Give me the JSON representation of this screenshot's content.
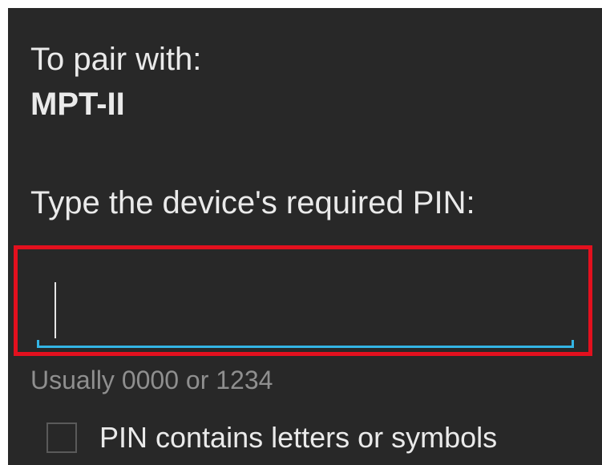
{
  "dialog": {
    "pair_label": "To pair with:",
    "device_name": "MPT-II",
    "pin_prompt": "Type the device's required PIN:",
    "pin_input": {
      "value": "",
      "placeholder": ""
    },
    "hint": "Usually 0000 or 1234",
    "checkbox": {
      "label": "PIN contains letters or symbols",
      "checked": false
    }
  },
  "colors": {
    "background": "#282828",
    "text": "#eaeaea",
    "hint_text": "#8f8f8f",
    "accent": "#33b5e5",
    "highlight": "#e3101e"
  }
}
